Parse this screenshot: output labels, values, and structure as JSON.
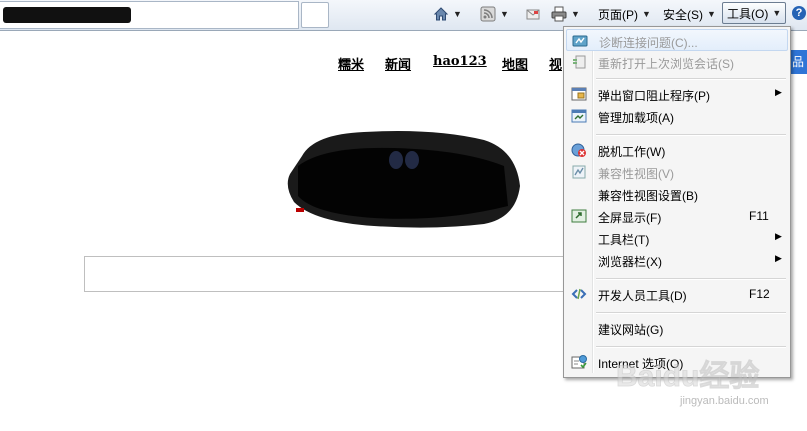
{
  "toolbar": {
    "page_label": "页面(P)",
    "safety_label": "安全(S)",
    "tools_label": "工具(O)",
    "help_label": "?"
  },
  "page": {
    "nav_links": [
      "糯米",
      "新闻",
      "hao123",
      "地图",
      "视"
    ],
    "right_button_label": "品"
  },
  "menu": {
    "items": [
      {
        "label": "诊断连接问题(C)...",
        "shortcut": "",
        "submenu": false,
        "disabled": true,
        "icon": "diagnose-icon"
      },
      {
        "label": "重新打开上次浏览会话(S)",
        "shortcut": "",
        "submenu": false,
        "disabled": true,
        "icon": "reopen-session-icon"
      },
      {
        "label": "弹出窗口阻止程序(P)",
        "shortcut": "",
        "submenu": true,
        "disabled": false,
        "icon": "popup-blocker-icon"
      },
      {
        "label": "管理加载项(A)",
        "shortcut": "",
        "submenu": false,
        "disabled": false,
        "icon": "addons-icon"
      },
      {
        "label": "脱机工作(W)",
        "shortcut": "",
        "submenu": false,
        "disabled": false,
        "icon": "offline-icon"
      },
      {
        "label": "兼容性视图(V)",
        "shortcut": "",
        "submenu": false,
        "disabled": true,
        "icon": "compat-view-icon"
      },
      {
        "label": "兼容性视图设置(B)",
        "shortcut": "",
        "submenu": false,
        "disabled": false,
        "icon": ""
      },
      {
        "label": "全屏显示(F)",
        "shortcut": "F11",
        "submenu": false,
        "disabled": false,
        "icon": "fullscreen-icon"
      },
      {
        "label": "工具栏(T)",
        "shortcut": "",
        "submenu": true,
        "disabled": false,
        "icon": ""
      },
      {
        "label": "浏览器栏(X)",
        "shortcut": "",
        "submenu": true,
        "disabled": false,
        "icon": ""
      },
      {
        "label": "开发人员工具(D)",
        "shortcut": "F12",
        "submenu": false,
        "disabled": false,
        "icon": "dev-tools-icon"
      },
      {
        "label": "建议网站(G)",
        "shortcut": "",
        "submenu": false,
        "disabled": false,
        "icon": ""
      },
      {
        "label": "Internet 选项(O)",
        "shortcut": "",
        "submenu": false,
        "disabled": false,
        "icon": "internet-options-icon"
      }
    ]
  },
  "watermark": {
    "brand": "Baidu经验",
    "url": "jingyan.baidu.com"
  }
}
